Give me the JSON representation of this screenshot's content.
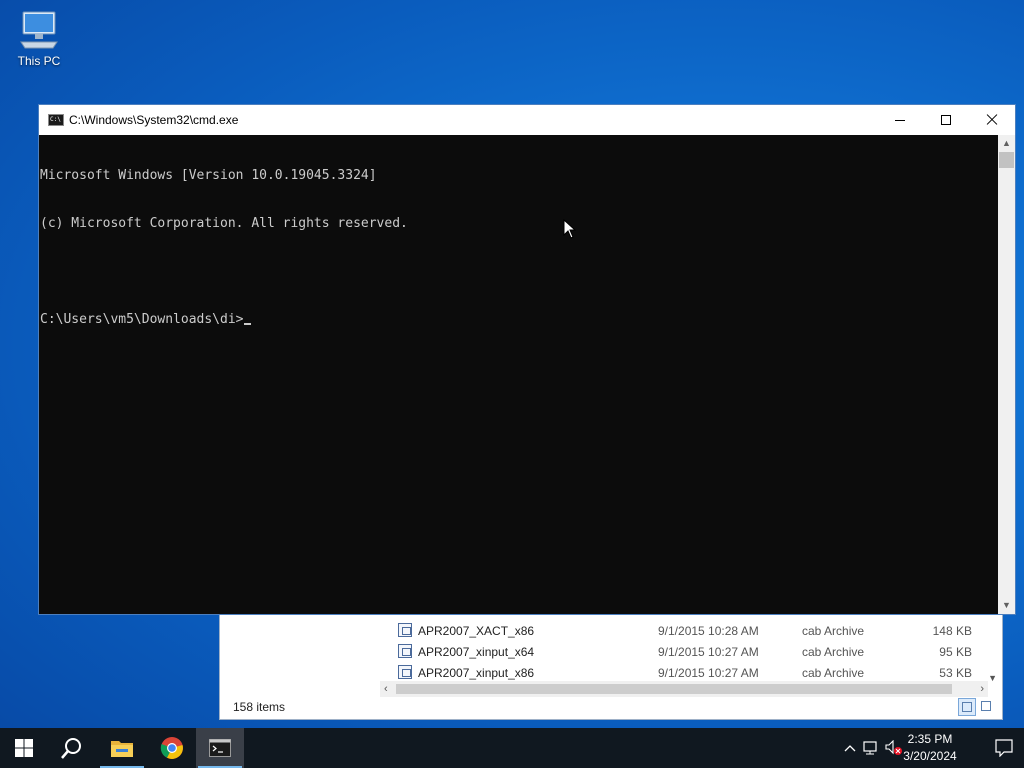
{
  "desktop": {
    "icons": [
      {
        "label": "This PC"
      }
    ]
  },
  "cmd_window": {
    "title": "C:\\Windows\\System32\\cmd.exe",
    "console_lines": [
      "Microsoft Windows [Version 10.0.19045.3324]",
      "(c) Microsoft Corporation. All rights reserved.",
      "",
      "C:\\Users\\vm5\\Downloads\\di>"
    ]
  },
  "explorer_window": {
    "files": [
      {
        "name": "APR2007_XACT_x86",
        "date": "9/1/2015 10:28 AM",
        "type": "cab Archive",
        "size": "148 KB"
      },
      {
        "name": "APR2007_xinput_x64",
        "date": "9/1/2015 10:27 AM",
        "type": "cab Archive",
        "size": "95 KB"
      },
      {
        "name": "APR2007_xinput_x86",
        "date": "9/1/2015 10:27 AM",
        "type": "cab Archive",
        "size": "53 KB"
      }
    ],
    "status_count": "158 items"
  },
  "taskbar": {
    "apps": [
      {
        "icon": "windows-start-icon"
      },
      {
        "icon": "search-icon"
      },
      {
        "icon": "file-explorer-icon"
      },
      {
        "icon": "chrome-icon"
      },
      {
        "icon": "command-prompt-icon"
      }
    ],
    "clock": {
      "time": "2:35 PM",
      "date": "3/20/2024"
    }
  },
  "colors": {
    "console_bg": "#0c0c0c",
    "console_text": "#cccccc",
    "taskbar_bg": "#101820",
    "desktop_accent": "#0f6fd0"
  }
}
